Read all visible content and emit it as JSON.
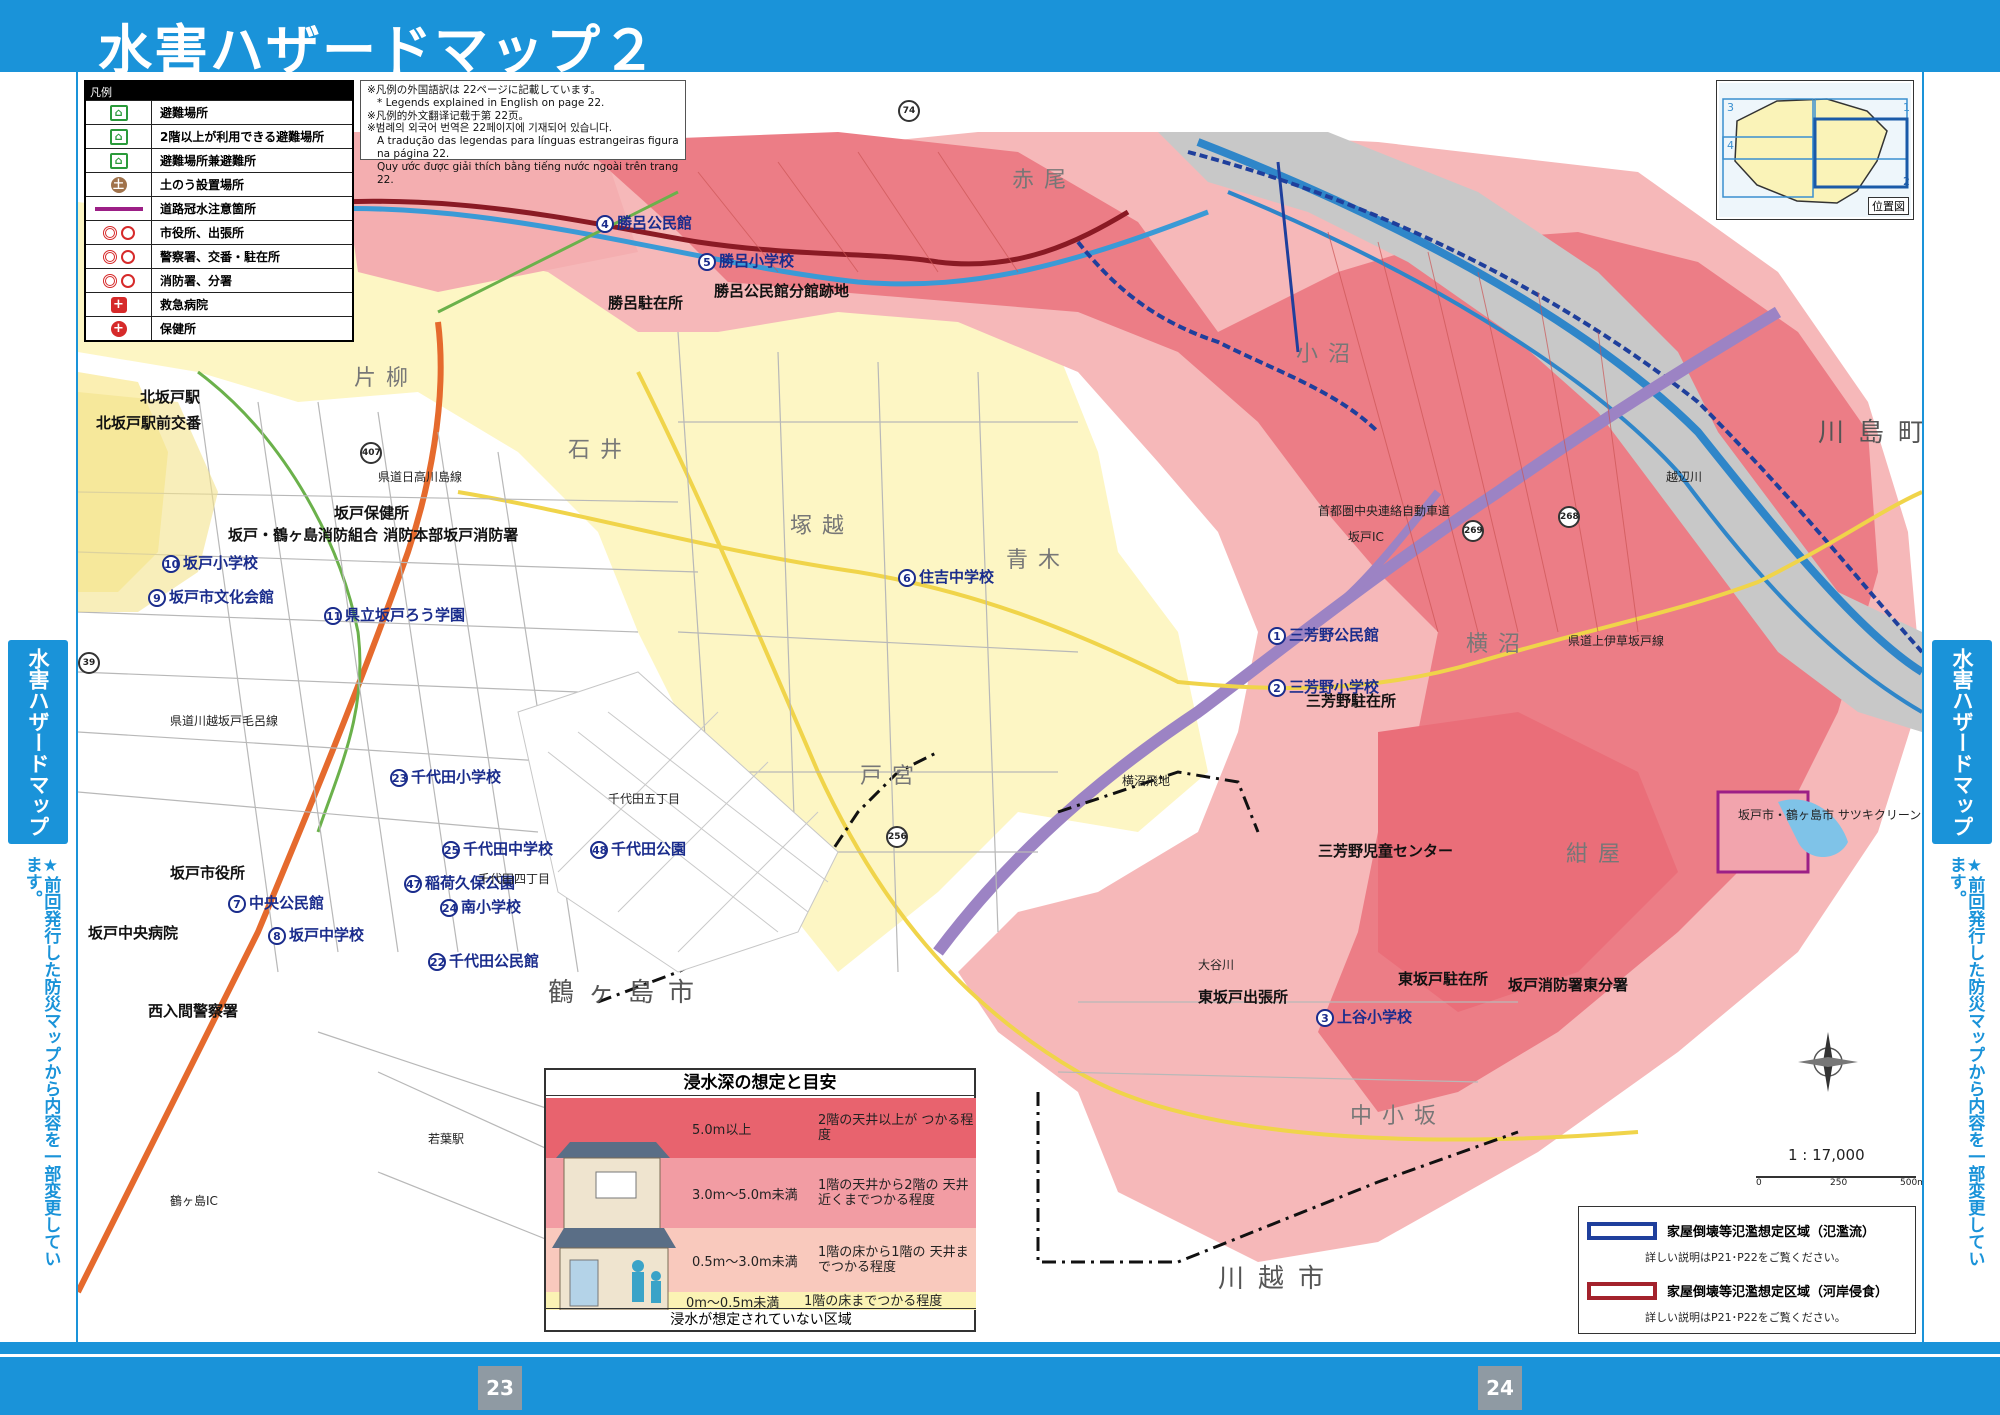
{
  "header": {
    "title": "水害ハザードマップ２"
  },
  "side": {
    "title": "水害ハザードマップ",
    "note": "★前回発行した防災マップから内容を一部変更しています。"
  },
  "pages": {
    "left": "23",
    "right": "24"
  },
  "legend": {
    "title": "凡例",
    "items": [
      {
        "label": "避難場所",
        "color": "#2a9a3a",
        "icon": "running-person-icon"
      },
      {
        "label": "2階以上が利用できる避難場所",
        "color": "#2a9a3a",
        "icon": "running-person-stairs-icon"
      },
      {
        "label": "避難場所兼避難所",
        "color": "#2a9a3a",
        "icon": "shelter-house-icon"
      },
      {
        "label": "土のう設置場所",
        "color": "#a0724a",
        "icon": "sandbag-icon"
      },
      {
        "label": "道路冠水注意箇所",
        "color": "#9c1f86",
        "icon": "flood-road-line-icon"
      },
      {
        "label": "市役所、出張所",
        "color": "#d62a2a",
        "icon": "city-hall-icon"
      },
      {
        "label": "警察署、交番・駐在所",
        "color": "#d62a2a",
        "icon": "police-icon"
      },
      {
        "label": "消防署、分署",
        "color": "#d62a2a",
        "icon": "fire-station-icon"
      },
      {
        "label": "救急病院",
        "color": "#d62a2a",
        "icon": "emergency-hospital-icon"
      },
      {
        "label": "保健所",
        "color": "#d62a2a",
        "icon": "health-center-icon"
      }
    ]
  },
  "language_note": [
    "※凡例の外国語訳は 22ページに記載しています。",
    "* Legends explained in English on page 22.",
    "※凡例的外文翻译记载于第 22页。",
    "※범례의 외국어 번역은 22페이지에 기재되어 있습니다.",
    "A tradução das legendas para línguas estrangeiras figura na página 22.",
    "Quy ước được giải thích bằng tiếng nước ngoài trên trang 22."
  ],
  "inset_map": {
    "caption": "位置図",
    "cells": [
      "1",
      "2",
      "3",
      "4"
    ]
  },
  "depth_table": {
    "title": "浸水深の想定と目安",
    "rows": [
      {
        "level": "5.0m以上",
        "desc": "2階の天井以上が つかる程度",
        "color": "#e8636e"
      },
      {
        "level": "3.0m〜5.0m未満",
        "desc": "1階の天井から2階の 天井近くまでつかる程度",
        "color": "#f29ca3"
      },
      {
        "level": "0.5m〜3.0m未満",
        "desc": "1階の床から1階の 天井までつかる程度",
        "color": "#f9c9bd"
      },
      {
        "level": "0m〜0.5m未満",
        "desc": "1階の床までつかる程度",
        "color": "#fbf3b4"
      }
    ],
    "footer": "浸水が想定されていない区域"
  },
  "flood_legend": [
    {
      "label": "家屋倒壊等氾濫想定区域（氾濫流）",
      "sub": "詳しい説明はP21･P22をご覧ください。",
      "color": "#1f3f9c"
    },
    {
      "label": "家屋倒壊等氾濫想定区域（河岸侵食）",
      "sub": "詳しい説明はP21･P22をご覧ください。",
      "color": "#a3222c"
    }
  ],
  "scale": {
    "ratio": "1 : 17,000",
    "ticks": [
      "0",
      "250",
      "500m"
    ]
  },
  "map": {
    "facilities": [
      {
        "n": "1",
        "label": "三芳野公民館"
      },
      {
        "n": "2",
        "label": "三芳野小学校"
      },
      {
        "n": "3",
        "label": "上谷小学校"
      },
      {
        "n": "4",
        "label": "勝呂公民館"
      },
      {
        "n": "5",
        "label": "勝呂小学校"
      },
      {
        "n": "6",
        "label": "住吉中学校"
      },
      {
        "n": "7",
        "label": "中央公民館"
      },
      {
        "n": "8",
        "label": "坂戸中学校"
      },
      {
        "n": "9",
        "label": "坂戸市文化会館"
      },
      {
        "n": "10",
        "label": "坂戸小学校"
      },
      {
        "n": "11",
        "label": "県立坂戸ろう学園"
      },
      {
        "n": "22",
        "label": "千代田公民館"
      },
      {
        "n": "23",
        "label": "千代田小学校"
      },
      {
        "n": "24",
        "label": "南小学校"
      },
      {
        "n": "25",
        "label": "千代田中学校"
      },
      {
        "n": "47",
        "label": "稲荷久保公園"
      },
      {
        "n": "48",
        "label": "千代田公園"
      }
    ],
    "towns": [
      "川島町",
      "鶴ヶ島市",
      "川越市",
      "石井",
      "塚越",
      "青木",
      "戸宮",
      "片柳",
      "横沼",
      "小沼",
      "紺屋",
      "中小坂",
      "赤尾"
    ],
    "labels": {
      "sakado_city_hall": "坂戸市役所",
      "sakado_health": "坂戸保健所",
      "fire_hq": "坂戸・鶴ヶ島消防組合 消防本部坂戸消防署",
      "kitasakado": "北坂戸駅",
      "kitasakado_koban": "北坂戸駅前交番",
      "sakado_central_hospital": "坂戸中央病院",
      "nishiiruma_police": "西入間警察署",
      "suguro_chuzai": "勝呂駐在所",
      "suguro_site": "勝呂公民館分館跡地",
      "miyoshino_chuzai": "三芳野駐在所",
      "miyoshino_jido": "三芳野児童センター",
      "higashisakado_office": "東坂戸出張所",
      "higashisakado_chuzai": "東坂戸駐在所",
      "fire_east": "坂戸消防署東分署",
      "sakado_ic": "坂戸IC",
      "tsurugashima_ic": "鶴ヶ島IC",
      "wakaba": "若葉駅",
      "kenou": "首都圏中央連絡自動車道",
      "yokonuma_hikoujou": "横沼飛地",
      "chiyoda5": "千代田五丁目",
      "chiyoda4": "千代田四丁目",
      "kawagoe_sakado": "県道川越坂戸毛呂線",
      "route_ueigusa": "県道上伊草坂戸線",
      "clean_center": "坂戸市・鶴ヶ島市 サツキクリーンセンター",
      "iruma_river": "越辺川",
      "oyagawa": "大谷川",
      "hidaka": "県道日高川島線"
    },
    "routes": [
      "74",
      "407",
      "39",
      "269",
      "256",
      "268"
    ]
  }
}
